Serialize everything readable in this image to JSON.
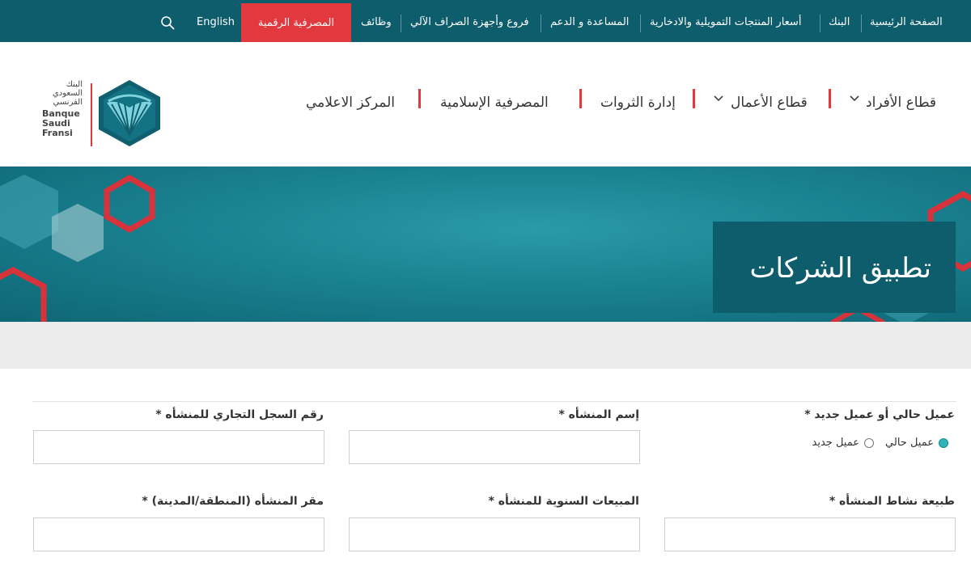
{
  "topbar": {
    "items": [
      "الصفحة الرئيسية",
      "البنك",
      "أسعار المنتجات التمويلية والادخارية",
      "المساعدة و الدعم",
      "فروع وأجهزة الصراف الآلي",
      "وظائف"
    ],
    "digital_banking": "المصرفية الرقمية",
    "language": "English",
    "search_icon": "search-icon",
    "accent": "#e2393f",
    "background": "#0e5d6c"
  },
  "logo": {
    "arabic_lines": [
      "البنك",
      "السعودي",
      "الفرنسي"
    ],
    "french_lines": [
      "Banque",
      "Saudi",
      "Fransi"
    ]
  },
  "nav": {
    "items": [
      "قطاع الأفراد",
      "قطاع الأعمال",
      "إدارة الثروات",
      "المصرفية الإسلامية",
      "المركز الاعلامي"
    ]
  },
  "banner": {
    "title": "تطبيق الشركات"
  },
  "form": {
    "customer_type_label": "عميل حالي أو عميل جديد *",
    "radio_existing": "عميل حالي",
    "radio_new": "عميل جديد",
    "selected": "existing",
    "establishment_name_label": "إسم المنشأه *",
    "cr_number_label": "رقم السجل التجاري للمنشأه *",
    "activity_label": "طبيعة نشاط المنشأه *",
    "annual_sales_label": "المبيعات السنوية للمنشأه *",
    "hq_label": "مقر المنشأه (المنطقة/المدينة) *"
  }
}
